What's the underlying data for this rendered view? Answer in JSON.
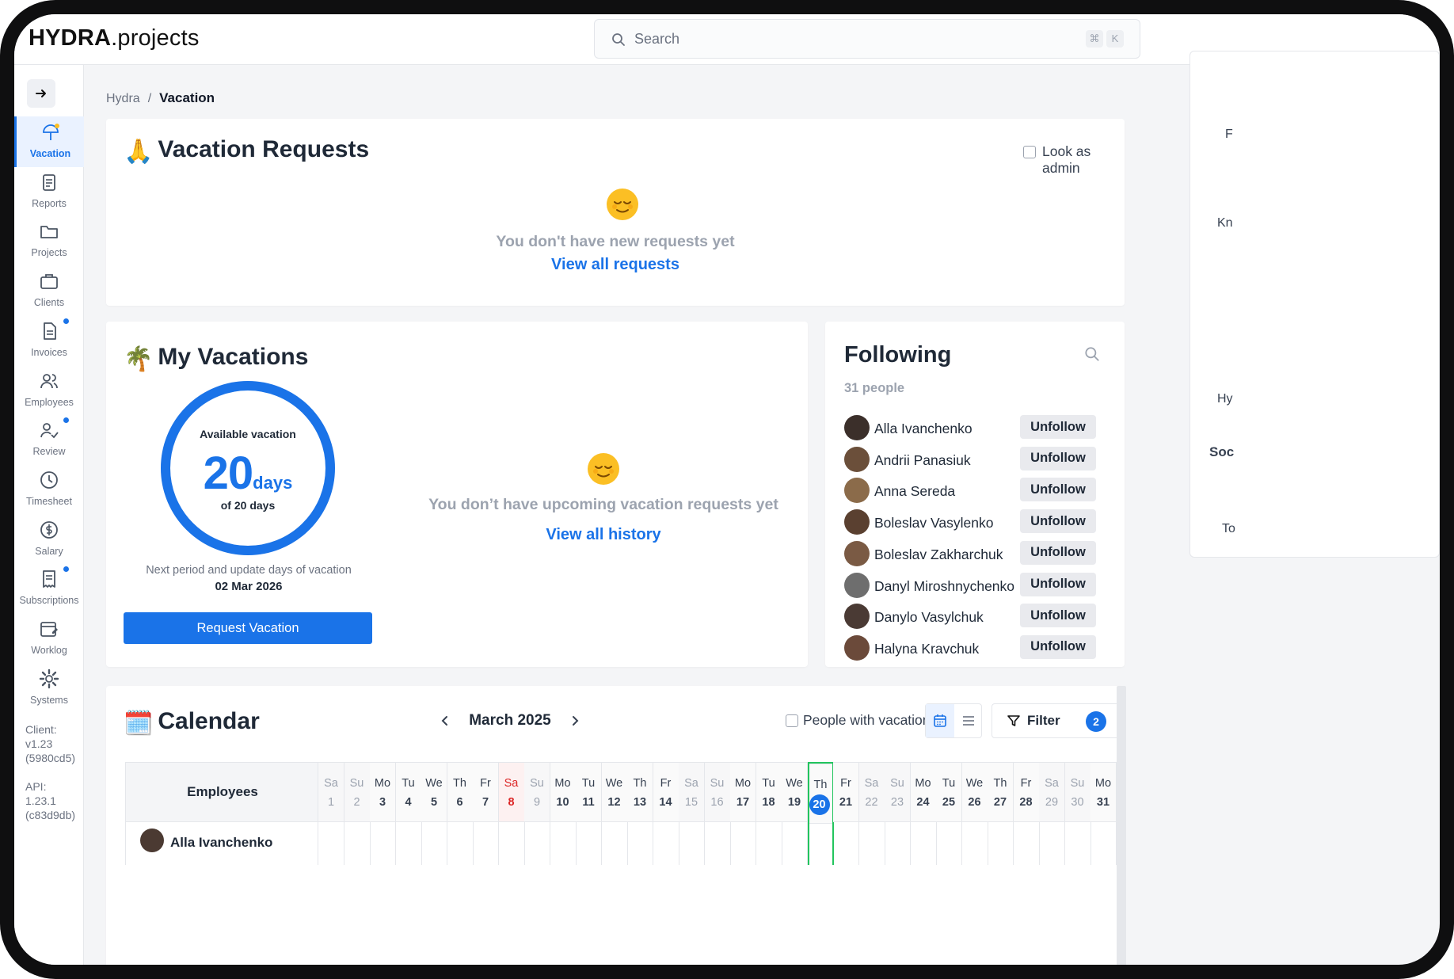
{
  "app": {
    "brand_bold": "HYDRA",
    "brand_rest": ".projects"
  },
  "search": {
    "placeholder": "Search",
    "kbd1": "⌘",
    "kbd2": "K"
  },
  "sidebar": {
    "items": [
      {
        "label": "Vacation",
        "icon": "umbrella-icon",
        "active": true
      },
      {
        "label": "Reports",
        "icon": "clipboard-icon"
      },
      {
        "label": "Projects",
        "icon": "folder-icon"
      },
      {
        "label": "Clients",
        "icon": "briefcase-icon"
      },
      {
        "label": "Invoices",
        "icon": "document-icon",
        "dot": true
      },
      {
        "label": "Employees",
        "icon": "users-icon"
      },
      {
        "label": "Review",
        "icon": "user-check-icon",
        "dot": true
      },
      {
        "label": "Timesheet",
        "icon": "clock-icon"
      },
      {
        "label": "Salary",
        "icon": "dollar-icon"
      },
      {
        "label": "Subscriptions",
        "icon": "receipt-icon",
        "dot": true
      },
      {
        "label": "Worklog",
        "icon": "calendar-edit-icon"
      },
      {
        "label": "Systems",
        "icon": "gear-icon"
      }
    ],
    "client_version": "Client: v1.23 (5980cd5)",
    "api_version": "API: 1.23.1 (c83d9db)"
  },
  "breadcrumb": {
    "root": "Hydra",
    "sep": "/",
    "current": "Vacation"
  },
  "requests": {
    "title": "Vacation Requests",
    "admin_label": "Look as admin",
    "empty": "You don't have new requests yet",
    "link": "View all requests"
  },
  "my_vacations": {
    "title": "My Vacations",
    "available_label": "Available vacation",
    "days_value": "20",
    "days_unit": "days",
    "of_total": "of 20 days",
    "available_fraction": 1.0,
    "next_period_label": "Next period and update days of vacation",
    "next_period_date": "02 Mar 2026",
    "request_button": "Request Vacation",
    "empty": "You don’t have upcoming vacation requests yet",
    "link": "View all history"
  },
  "following": {
    "title": "Following",
    "count": "31 people",
    "unfollow_label": "Unfollow",
    "people": [
      "Alla Ivanchenko",
      "Andrii Panasiuk",
      "Anna Sereda",
      "Boleslav Vasylenko",
      "Boleslav Zakharchuk",
      "Danyl Miroshnychenko",
      "Danylo Vasylchuk",
      "Halyna Kravchuk"
    ]
  },
  "calendar": {
    "title": "Calendar",
    "month": "March 2025",
    "people_with_vacation": "People with vacation",
    "filter_label": "Filter",
    "filter_count": "2",
    "employees_header": "Employees",
    "first_row_name": "Alla Ivanchenko",
    "days": [
      {
        "n": "Sa",
        "d": "1",
        "t": "we"
      },
      {
        "n": "Su",
        "d": "2",
        "t": "we"
      },
      {
        "n": "Mo",
        "d": "3"
      },
      {
        "n": "Tu",
        "d": "4"
      },
      {
        "n": "We",
        "d": "5"
      },
      {
        "n": "Th",
        "d": "6"
      },
      {
        "n": "Fr",
        "d": "7"
      },
      {
        "n": "Sa",
        "d": "8",
        "t": "hol"
      },
      {
        "n": "Su",
        "d": "9",
        "t": "we"
      },
      {
        "n": "Mo",
        "d": "10"
      },
      {
        "n": "Tu",
        "d": "11"
      },
      {
        "n": "We",
        "d": "12"
      },
      {
        "n": "Th",
        "d": "13"
      },
      {
        "n": "Fr",
        "d": "14"
      },
      {
        "n": "Sa",
        "d": "15",
        "t": "we"
      },
      {
        "n": "Su",
        "d": "16",
        "t": "we"
      },
      {
        "n": "Mo",
        "d": "17"
      },
      {
        "n": "Tu",
        "d": "18"
      },
      {
        "n": "We",
        "d": "19"
      },
      {
        "n": "Th",
        "d": "20",
        "t": "today"
      },
      {
        "n": "Fr",
        "d": "21"
      },
      {
        "n": "Sa",
        "d": "22",
        "t": "we"
      },
      {
        "n": "Su",
        "d": "23",
        "t": "we"
      },
      {
        "n": "Mo",
        "d": "24"
      },
      {
        "n": "Tu",
        "d": "25"
      },
      {
        "n": "We",
        "d": "26"
      },
      {
        "n": "Th",
        "d": "27"
      },
      {
        "n": "Fr",
        "d": "28"
      },
      {
        "n": "Sa",
        "d": "29",
        "t": "we"
      },
      {
        "n": "Su",
        "d": "30",
        "t": "we"
      },
      {
        "n": "Mo",
        "d": "31"
      }
    ]
  },
  "side_panel": {
    "fragments": [
      "F",
      "Kn",
      "Hy",
      "Soc",
      "To"
    ]
  },
  "colors": {
    "accent": "#1a73e8",
    "holiday": "#dc2626",
    "today": "#22c55e"
  }
}
